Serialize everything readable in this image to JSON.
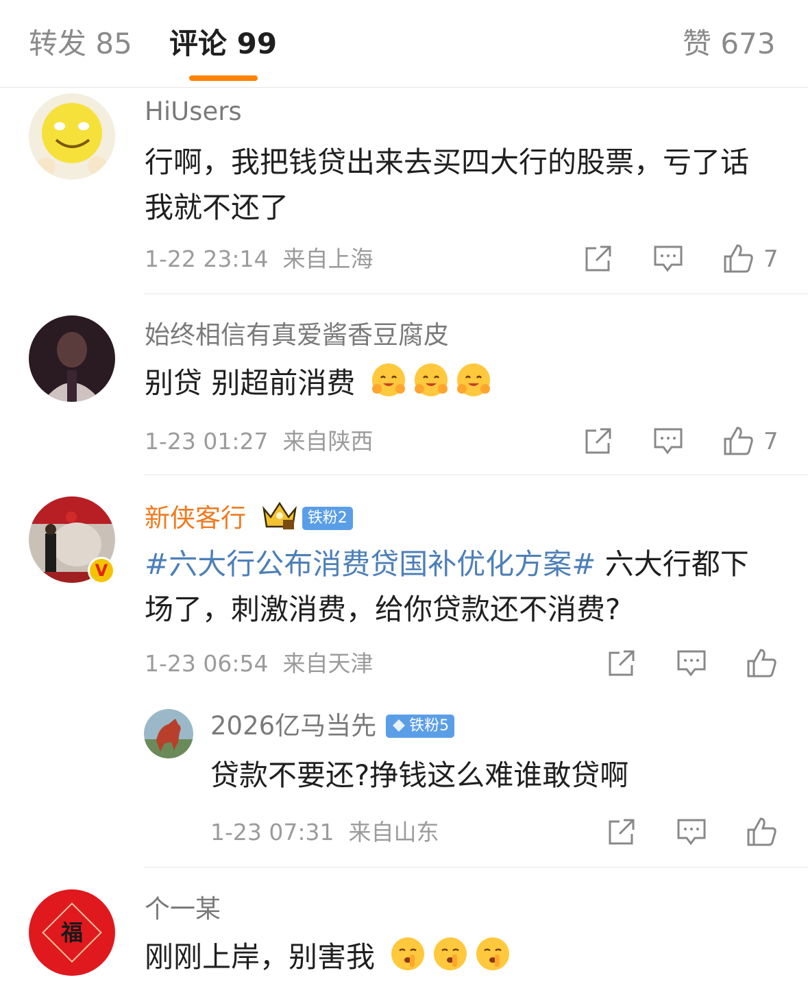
{
  "tabs": {
    "repost": "转发 85",
    "comments": "评论 99",
    "likes": "赞 673"
  },
  "comments": [
    {
      "username": "HiUsers",
      "text": "行啊，我把钱贷出来去买四大行的股票，亏了话我就不还了",
      "time": "1-22 23:14",
      "location": "来自上海",
      "like_count": "7"
    },
    {
      "username": "始终相信有真爱酱香豆腐皮",
      "text": "别贷 别超前消费",
      "time": "1-23 01:27",
      "location": "来自陕西",
      "like_count": "7"
    },
    {
      "username": "新侠客行",
      "badge": "铁粉2",
      "topic": "#六大行公布消费贷国补优化方案#",
      "text": " 六大行都下场了，刺激消费，给你贷款还不消费?",
      "time": "1-23 06:54",
      "location": "来自天津",
      "like_count": ""
    },
    {
      "username": "个一某",
      "text": "刚刚上岸，别害我"
    }
  ],
  "reply": {
    "username": "2026亿马当先",
    "badge": "铁粉5",
    "text": "贷款不要还?挣钱这么难谁敢贷啊",
    "time": "1-23 07:31",
    "location": "来自山东"
  },
  "avatar_fu_char": "福",
  "verified_mark": "V",
  "colors": {
    "accent": "#ff8200",
    "topic": "#4c7fb8",
    "badge": "#5b9ee8",
    "username_vip": "#f07a1f"
  }
}
